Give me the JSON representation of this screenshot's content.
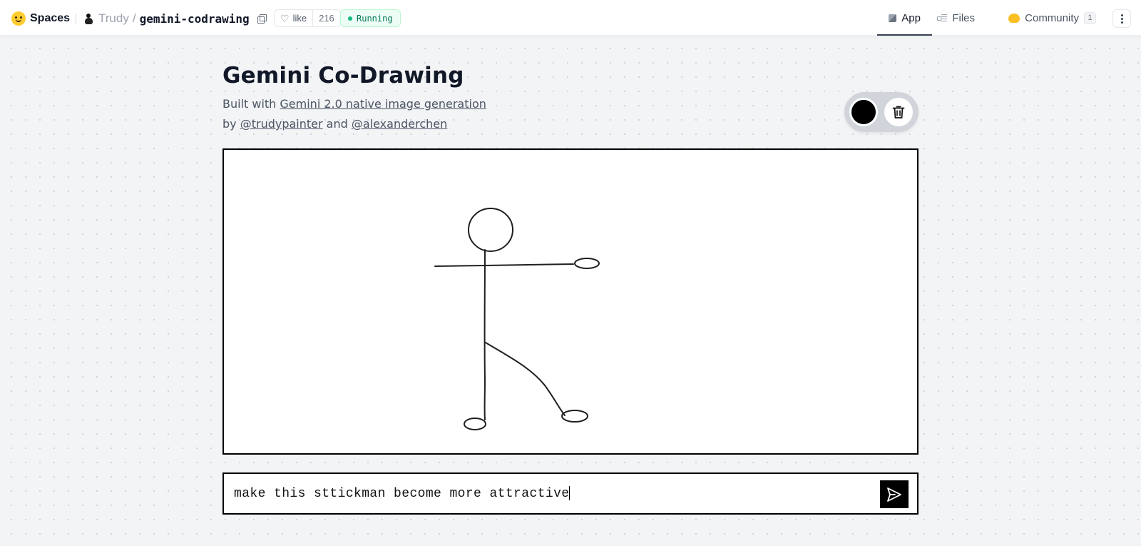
{
  "topbar": {
    "brand": "Spaces",
    "owner": "Trudy",
    "separator": "/",
    "repo_name": "gemini-codrawing",
    "like_label": "like",
    "like_count": "216",
    "status": "Running",
    "tabs": [
      {
        "label": "App",
        "icon": "app-cube-icon",
        "active": true
      },
      {
        "label": "Files",
        "icon": "files-icon",
        "active": false
      },
      {
        "label": "Community",
        "icon": "community-icon",
        "active": false,
        "badge": "1"
      }
    ]
  },
  "app": {
    "title": "Gemini Co-Drawing",
    "built_with_prefix": "Built with ",
    "built_with_link": "Gemini 2.0 native image generation",
    "by_prefix": "by ",
    "author1": "@trudypainter",
    "and": " and ",
    "author2": "@alexanderchen",
    "brush_color": "#000000"
  },
  "prompt": {
    "value": "make this sttickman become more attractive"
  },
  "colors": {
    "accent": "#000000",
    "status_green": "#10b981",
    "page_bg": "#f3f4f6"
  }
}
